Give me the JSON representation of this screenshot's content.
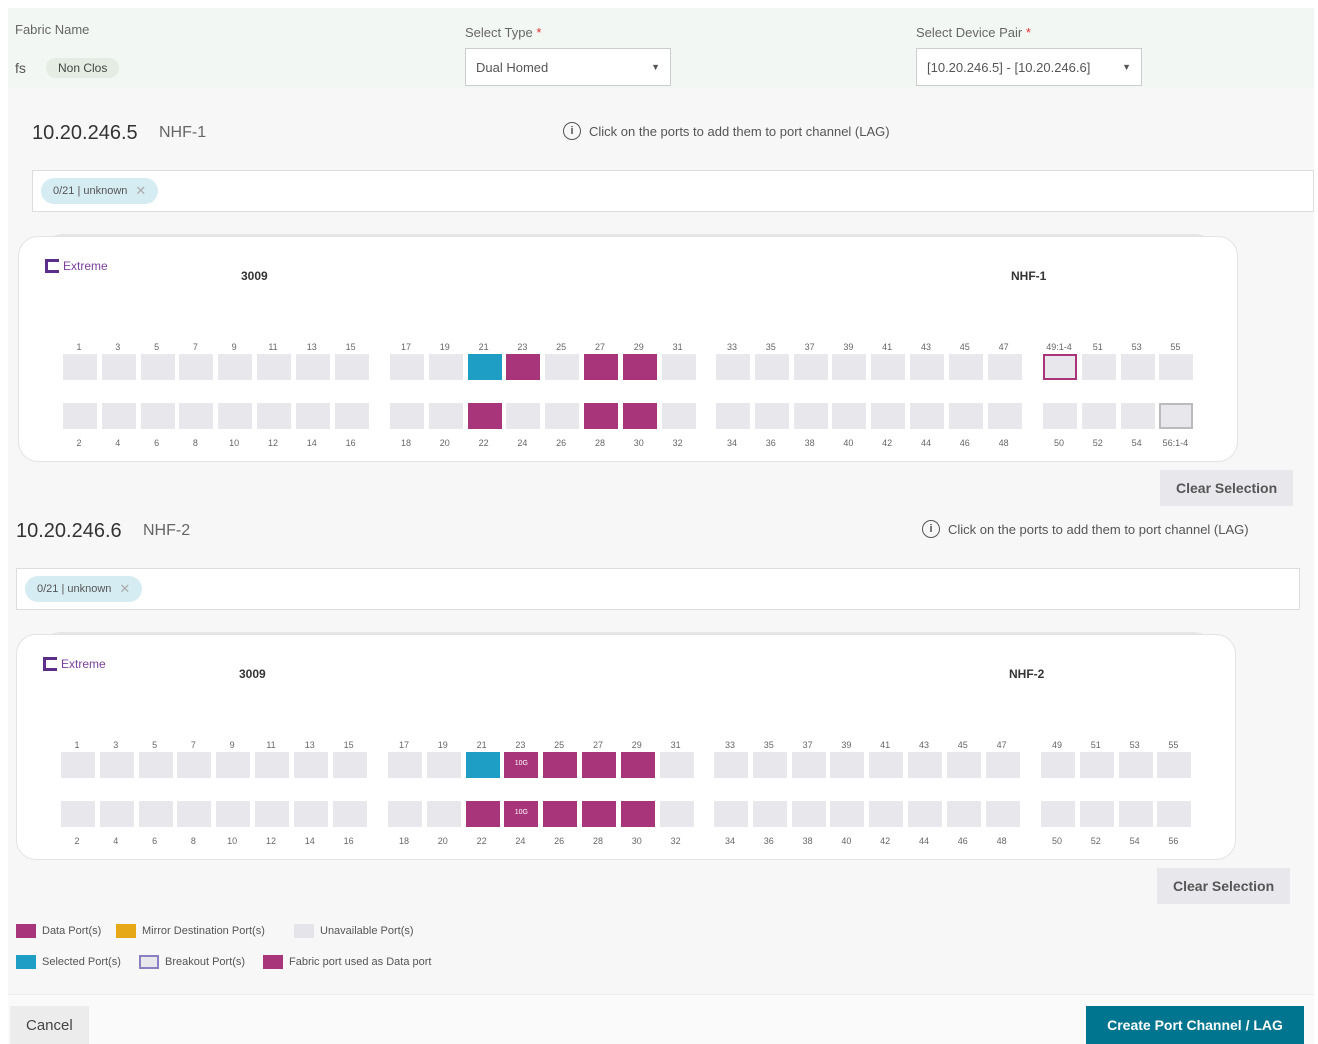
{
  "fabric": {
    "label": "Fabric Name",
    "value": "fs",
    "badge": "Non Clos"
  },
  "type": {
    "label": "Select Type",
    "required": "*",
    "value": "Dual Homed"
  },
  "pair": {
    "label": "Select Device Pair",
    "required": "*",
    "value": "[10.20.246.5] - [10.20.246.6]"
  },
  "devices": [
    {
      "ip": "10.20.246.5",
      "name": "NHF-1",
      "info": "Click on the ports to add them to port channel (LAG)",
      "chip": "0/21 | unknown",
      "logo": "Extreme",
      "model": "3009",
      "switch_name": "NHF-1",
      "top_labels": [
        "1",
        "3",
        "5",
        "7",
        "9",
        "11",
        "13",
        "15",
        "17",
        "19",
        "21",
        "23",
        "25",
        "27",
        "29",
        "31",
        "33",
        "35",
        "37",
        "39",
        "41",
        "43",
        "45",
        "47",
        "49:1-4",
        "51",
        "53",
        "55"
      ],
      "bottom_labels": [
        "2",
        "4",
        "6",
        "8",
        "10",
        "12",
        "14",
        "16",
        "18",
        "20",
        "22",
        "24",
        "26",
        "28",
        "30",
        "32",
        "34",
        "36",
        "38",
        "40",
        "42",
        "44",
        "46",
        "48",
        "50",
        "52",
        "54",
        "56:1-4"
      ],
      "top_states": [
        "u",
        "u",
        "u",
        "u",
        "u",
        "u",
        "u",
        "u",
        "u",
        "u",
        "s",
        "d",
        "u",
        "d",
        "d",
        "u",
        "u",
        "u",
        "u",
        "u",
        "u",
        "u",
        "u",
        "u",
        "b",
        "u",
        "u",
        "u"
      ],
      "bottom_states": [
        "u",
        "u",
        "u",
        "u",
        "u",
        "u",
        "u",
        "u",
        "u",
        "u",
        "d",
        "u",
        "u",
        "d",
        "d",
        "u",
        "u",
        "u",
        "u",
        "u",
        "u",
        "u",
        "u",
        "u",
        "u",
        "u",
        "u",
        "bu"
      ],
      "top_tags": {},
      "bottom_tags": {},
      "clear": "Clear Selection"
    },
    {
      "ip": "10.20.246.6",
      "name": "NHF-2",
      "info": "Click on the ports to add them to port channel (LAG)",
      "chip": "0/21 | unknown",
      "logo": "Extreme",
      "model": "3009",
      "switch_name": "NHF-2",
      "top_labels": [
        "1",
        "3",
        "5",
        "7",
        "9",
        "11",
        "13",
        "15",
        "17",
        "19",
        "21",
        "23",
        "25",
        "27",
        "29",
        "31",
        "33",
        "35",
        "37",
        "39",
        "41",
        "43",
        "45",
        "47",
        "49",
        "51",
        "53",
        "55"
      ],
      "bottom_labels": [
        "2",
        "4",
        "6",
        "8",
        "10",
        "12",
        "14",
        "16",
        "18",
        "20",
        "22",
        "24",
        "26",
        "28",
        "30",
        "32",
        "34",
        "36",
        "38",
        "40",
        "42",
        "44",
        "46",
        "48",
        "50",
        "52",
        "54",
        "56"
      ],
      "top_states": [
        "u",
        "u",
        "u",
        "u",
        "u",
        "u",
        "u",
        "u",
        "u",
        "u",
        "s",
        "d",
        "d",
        "d",
        "d",
        "u",
        "u",
        "u",
        "u",
        "u",
        "u",
        "u",
        "u",
        "u",
        "u",
        "u",
        "u",
        "u"
      ],
      "bottom_states": [
        "u",
        "u",
        "u",
        "u",
        "u",
        "u",
        "u",
        "u",
        "u",
        "u",
        "d",
        "d",
        "d",
        "d",
        "d",
        "u",
        "u",
        "u",
        "u",
        "u",
        "u",
        "u",
        "u",
        "u",
        "u",
        "u",
        "u",
        "u"
      ],
      "top_tags": {
        "11": "10G"
      },
      "bottom_tags": {
        "11": "10G"
      },
      "clear": "Clear Selection"
    }
  ],
  "legend": {
    "data": "Data Port(s)",
    "mirror": "Mirror Destination Port(s)",
    "unavailable": "Unavailable Port(s)",
    "selected": "Selected Port(s)",
    "breakout": "Breakout Port(s)",
    "fabric": "Fabric port used as Data port",
    "colors": {
      "data": "#a8347a",
      "mirror": "#e6a817",
      "unavailable": "#e4e4ea",
      "selected": "#1e9ec4",
      "breakout": "#8a7fc0"
    }
  },
  "footer": {
    "cancel": "Cancel",
    "create": "Create Port Channel / LAG"
  }
}
